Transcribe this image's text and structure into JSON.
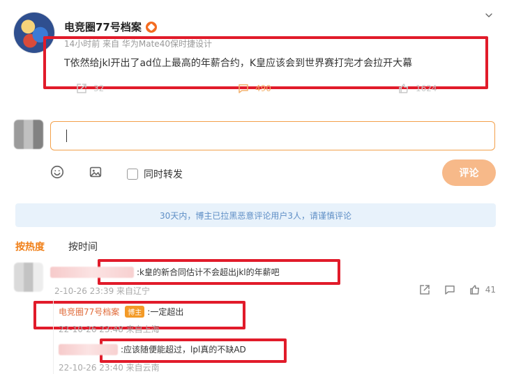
{
  "post": {
    "username": "电竞圈77号档案",
    "meta": "14小时前 来自 华为Mate40保时捷设计",
    "text": "T依然给jkl开出了ad位上最高的年薪合约，K皇应该会到世界赛打完才会拉开大幕",
    "actions": {
      "share_count": "32",
      "comment_count": "490",
      "like_count": "1624"
    }
  },
  "composer": {
    "placeholder": "",
    "repost_label": "同时转发",
    "submit_label": "评论"
  },
  "notice": {
    "text": "30天内，博主已拉黑恶意评论用户3人，请谨慎评论"
  },
  "sort": {
    "tabs": [
      {
        "label": "按热度"
      },
      {
        "label": "按时间"
      }
    ]
  },
  "comments": [
    {
      "text": ":k皇的新合同估计不会超出jkl的年薪吧",
      "time": "2-10-26 23:39 来自辽宁",
      "like_count": "41"
    }
  ],
  "replies": [
    {
      "author": "电竞圈77号档案",
      "badge": "博主",
      "text": ":一定超出",
      "time": "22-10-26 23:48 来自上海"
    },
    {
      "text": ":应该随便能超过，lpl真的不缺AD",
      "time": "22-10-26 23:40 来自云南"
    }
  ],
  "colors": {
    "accent_orange": "#f07f17",
    "highlight_red": "#e11b2a",
    "notice_bg": "#e8f2fb",
    "notice_text": "#5f8fc6",
    "comment_btn_bg": "#f7b989"
  }
}
